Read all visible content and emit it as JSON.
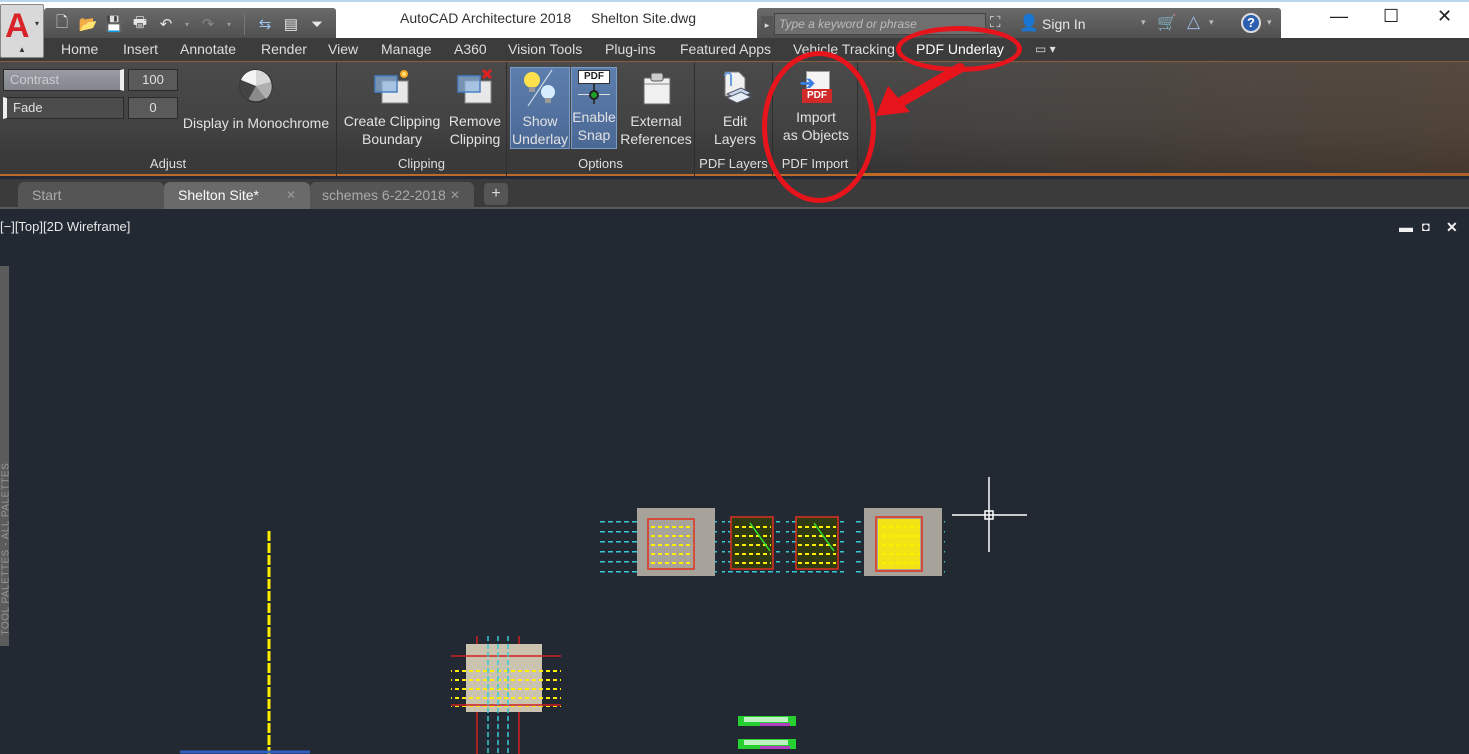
{
  "window": {
    "app_title": "AutoCAD Architecture 2018",
    "file_title": "Shelton Site.dwg",
    "controls": {
      "minimize": "—",
      "maximize": "☐",
      "close": "✕"
    }
  },
  "app_button": {
    "logo": "A",
    "dropdown": "▾",
    "pin": "▲"
  },
  "quick_access": {
    "icons": [
      "new-icon",
      "open-icon",
      "save-icon",
      "plot-icon",
      "undo-icon",
      "redo-icon",
      "share-icon",
      "properties-icon",
      "customize-icon"
    ],
    "glyphs": {
      "new": "🗋",
      "open": "📂",
      "save": "💾",
      "plot": "🖶",
      "undo": "↶",
      "redo": "↷",
      "share": "⇆",
      "properties": "▤",
      "customize": "⏷"
    }
  },
  "infocenter": {
    "search_placeholder": "Type a keyword or phrase",
    "sign_in": "Sign In",
    "glyphs": {
      "search_arrow": "▸",
      "binoculars": "⛶",
      "user": "👤",
      "cart": "🛒",
      "a360": "△",
      "help": "?",
      "dd": "▾"
    }
  },
  "ribbon_tabs": [
    {
      "label": "Home"
    },
    {
      "label": "Insert"
    },
    {
      "label": "Annotate"
    },
    {
      "label": "Render"
    },
    {
      "label": "View"
    },
    {
      "label": "Manage"
    },
    {
      "label": "A360"
    },
    {
      "label": "Vision Tools"
    },
    {
      "label": "Plug-ins"
    },
    {
      "label": "Featured Apps"
    },
    {
      "label": "Vehicle Tracking"
    },
    {
      "label": "PDF Underlay",
      "active": true
    }
  ],
  "ribbon_extra": {
    "workspace_glyph": "▭ ▾"
  },
  "ribbon": {
    "adjust": {
      "title": "Adjust",
      "contrast_label": "Contrast",
      "contrast_value": "100",
      "fade_label": "Fade",
      "fade_value": "0",
      "monochrome_label": "Display in Monochrome"
    },
    "clipping": {
      "title": "Clipping",
      "create_l1": "Create Clipping",
      "create_l2": "Boundary",
      "remove_l1": "Remove",
      "remove_l2": "Clipping"
    },
    "options": {
      "title": "Options",
      "show_l1": "Show",
      "show_l2": "Underlay",
      "snap_l1": "Enable",
      "snap_l2": "Snap",
      "xref_l1": "External",
      "xref_l2": "References",
      "pdf_badge": "PDF"
    },
    "pdf_layers": {
      "title": "PDF Layers",
      "edit_l1": "Edit",
      "edit_l2": "Layers"
    },
    "pdf_import": {
      "title": "PDF Import",
      "import_l1": "Import",
      "import_l2": "as Objects",
      "pdf_badge": "PDF"
    }
  },
  "file_tabs": [
    {
      "label": "Start",
      "active": false
    },
    {
      "label": "Shelton Site*",
      "active": true,
      "close": "✕"
    },
    {
      "label": "schemes 6-22-2018",
      "active": false,
      "close": "✕"
    }
  ],
  "file_tab_add": "+",
  "viewport": {
    "label": "[−][Top][2D Wireframe]",
    "controls": {
      "minimize": "▬",
      "restore": "◘",
      "close": "✕"
    },
    "palette_label": "TOOL PALETTES - ALL PALETTES"
  },
  "colors": {
    "annotation_red": "#e8141c",
    "viewport_bg": "#222933",
    "ribbon_active": "#4b6894",
    "accent_orange": "#c06a2a"
  }
}
